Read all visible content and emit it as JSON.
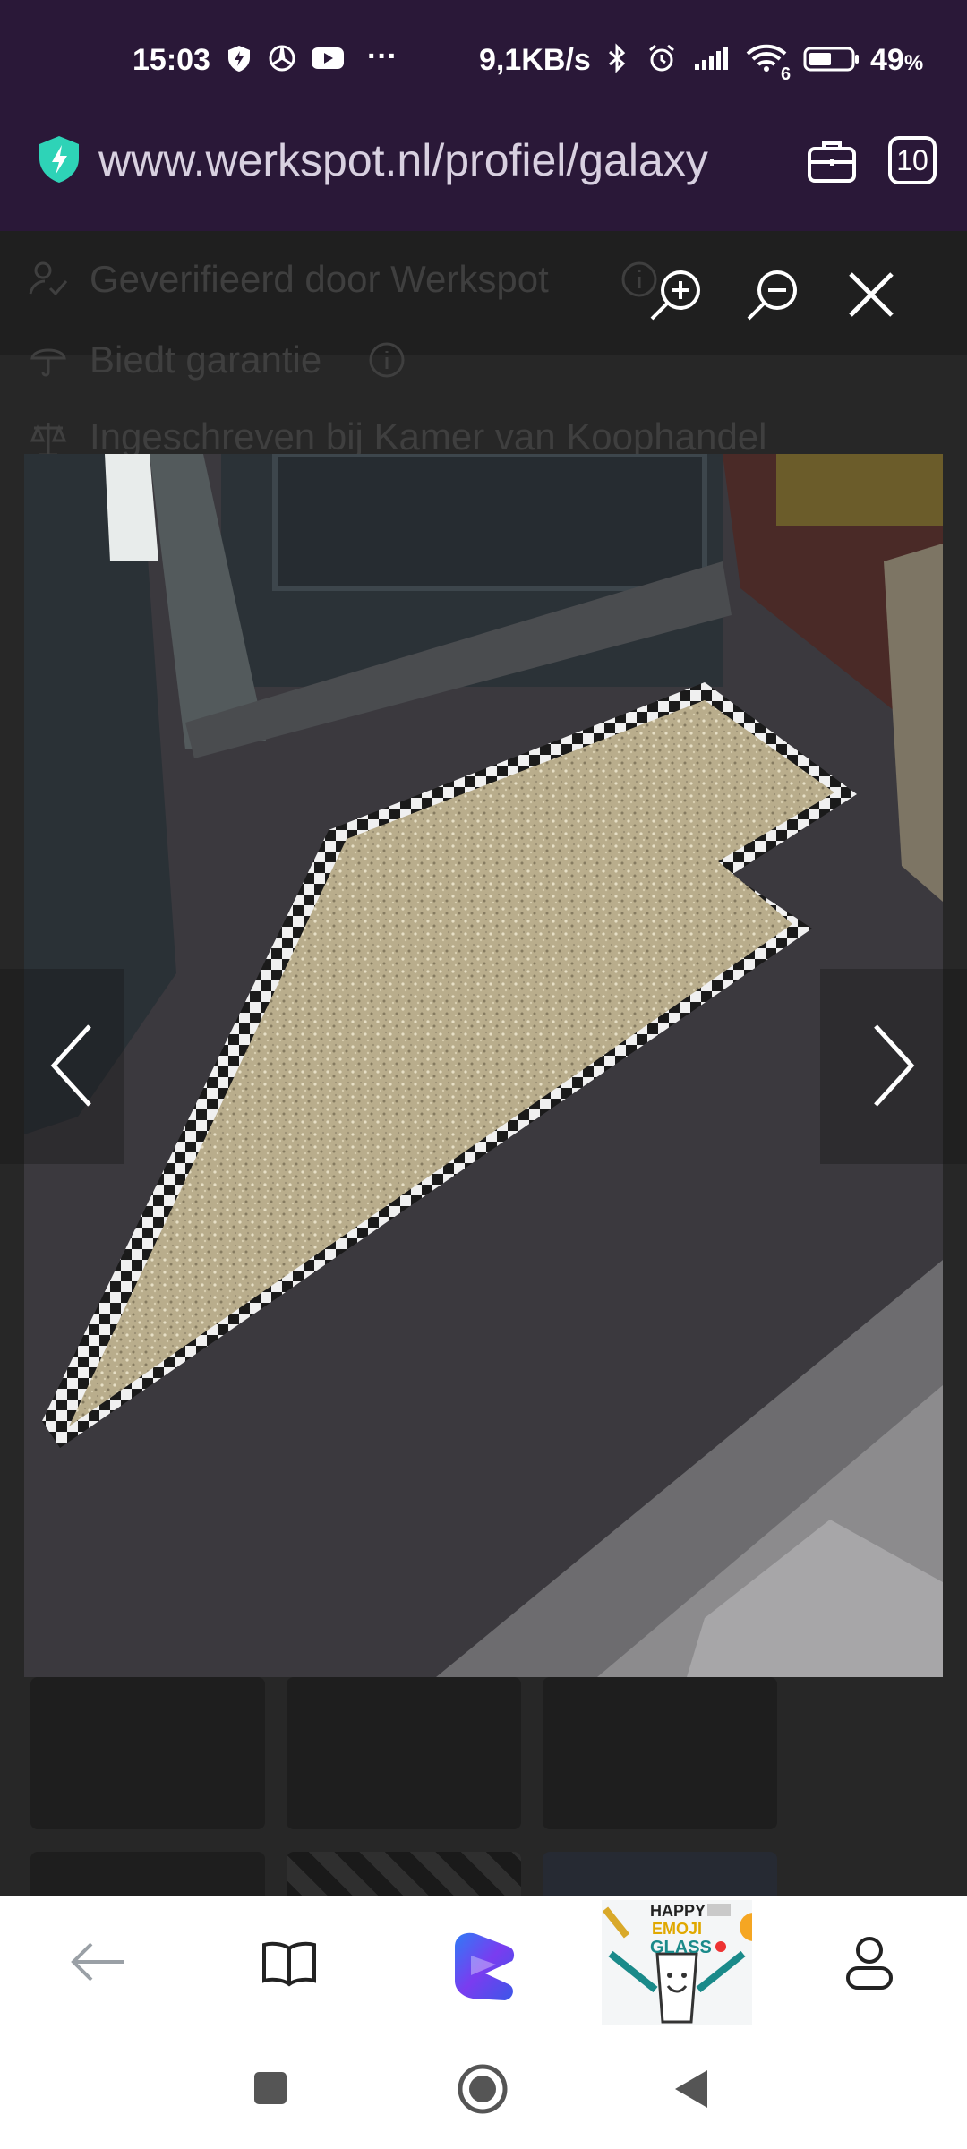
{
  "status_bar": {
    "time": "15:03",
    "network_speed": "9,1KB/s",
    "battery_percent": "49",
    "battery_unit": "%",
    "more_dots": "···",
    "wifi_badge": "6"
  },
  "url_bar": {
    "url": "www.werkspot.nl/profiel/galaxy",
    "tab_count": "10",
    "shield_icon": "shield-bolt-icon",
    "briefcase_icon": "briefcase-icon"
  },
  "background_page": {
    "items": [
      {
        "icon": "verified-user-icon",
        "label": "Geverifieerd door Werkspot",
        "info_icon": "info-icon"
      },
      {
        "icon": "umbrella-icon",
        "label": "Biedt garantie",
        "info_icon": "info-icon"
      },
      {
        "icon": "scales-icon",
        "label": "Ingeschreven bij Kamer van Koophandel"
      }
    ]
  },
  "viewer": {
    "zoom_in_icon": "zoom-in-icon",
    "zoom_out_icon": "zoom-out-icon",
    "close_icon": "close-icon",
    "prev_icon": "chevron-left-icon",
    "next_icon": "chevron-right-icon"
  },
  "bottom_bar": {
    "back_icon": "arrow-left-icon",
    "reader_icon": "book-icon",
    "ai_icon": "copilot-icon",
    "promo_texts": [
      "HAPPY",
      "EMOJI",
      "GLASS"
    ],
    "profile_icon": "person-icon"
  },
  "system_nav": {
    "recents_icon": "square-icon",
    "home_icon": "circle-icon",
    "back_icon": "triangle-back-icon"
  },
  "colors": {
    "status_bg": "#2a1838",
    "accent_teal": "#2ed3b7",
    "overlay_bg": "#2b2b2b"
  }
}
